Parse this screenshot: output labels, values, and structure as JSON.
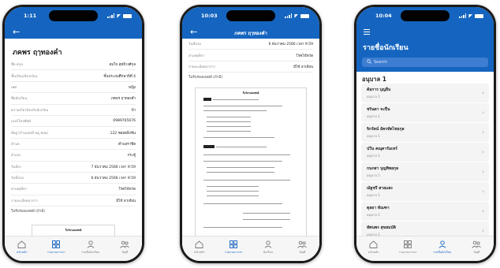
{
  "phone1": {
    "time": "1:11",
    "name": "ภคพร ฤๅทองคำ",
    "rows": [
      {
        "k": "ชื่อ-สกุล",
        "v": "สมใจ สุทธิวงศ์กุล"
      },
      {
        "k": "ชั้นเรียน/ห้องเรียน",
        "v": "ชั้นประถมศึกษาปีที่ 4"
      },
      {
        "k": "เพศ",
        "v": "หญิง"
      },
      {
        "k": "ชื่อนักเรียน",
        "v": "ภคพร ฤๅทองคำ"
      },
      {
        "k": "ความเกี่ยวข้องกับนักเรียน",
        "v": "ป้า"
      },
      {
        "k": "เบอร์โทรศัพท์",
        "v": "0989765676"
      },
      {
        "k": "ที่อยู่ (บ้านเลขที่ หมู่ ซอย)",
        "v": "122 ซอยตลิ่งชัน"
      },
      {
        "k": "ตำบล",
        "v": "ตำบลราชิต"
      },
      {
        "k": "อำเภอ",
        "v": "กระทู้"
      },
      {
        "k": "วันที่ลา",
        "v": "7 ธันวาคม 2566 เวลา 9:59"
      },
      {
        "k": "วันที่ป่วย",
        "v": "6 ธันวาคม 2566 เวลา 9:59"
      },
      {
        "k": "สาเหตุที่ลา",
        "v": "โรคไข้หวัด"
      },
      {
        "k": "รายละเอียดอาการ",
        "v": "มีไข้ อาเจียน"
      }
    ],
    "section": "ใบรับรองแพทย์ (ถ้ามี)",
    "doc_title": "ใบรับรองแพทย์"
  },
  "phone2": {
    "time": "10:03",
    "title": "ภคพร ฤๅทองคำ",
    "rows": [
      {
        "k": "วันที่ป่วย",
        "v": "6 ธันวาคม 2566 เวลา 9:59"
      },
      {
        "k": "สาเหตุที่ลา",
        "v": "โรคไข้หวัด"
      },
      {
        "k": "รายละเอียดอาการ",
        "v": "มีไข้ อาเจียน"
      }
    ],
    "section": "ใบรับรองแพทย์ (ถ้ามี)",
    "doc_title": "ใบรับรองแพทย์"
  },
  "phone3": {
    "time": "10:04",
    "title": "รายชื่อนักเรียน",
    "search_placeholder": "Search",
    "class_heading": "อนุบาล 1",
    "students": [
      {
        "name": "ต้อการ บุญยืน",
        "class": "อนุบาล 1"
      },
      {
        "name": "ชรินดา จะปืน",
        "class": "อนุบาล 1"
      },
      {
        "name": "จิกรัตน์ อัครทัดไชยกุล",
        "class": "อนุบาล 1"
      },
      {
        "name": "ปวีน คณุตารัมเทร์",
        "class": "อนุบาล 1"
      },
      {
        "name": "กนกสา บุญทิพยกุล",
        "class": "อนุบาล 1"
      },
      {
        "name": "ณัฐชรี สายแสง",
        "class": "อนุบาล 1"
      },
      {
        "name": "ดุลยา ทัณฑา",
        "class": "อนุบาล 1"
      },
      {
        "name": "ทัศนพร สุขสมบัติ",
        "class": "อนุบาล 1"
      }
    ]
  },
  "nav": {
    "home": "หน้าหลัก",
    "report": "รายงานการลา",
    "students": "รายชื่อนักเรียน",
    "students_short": "นักเรียน",
    "account": "บัญชี"
  },
  "colors": {
    "primary": "#1565c0",
    "active_pill": "#1565c0"
  }
}
